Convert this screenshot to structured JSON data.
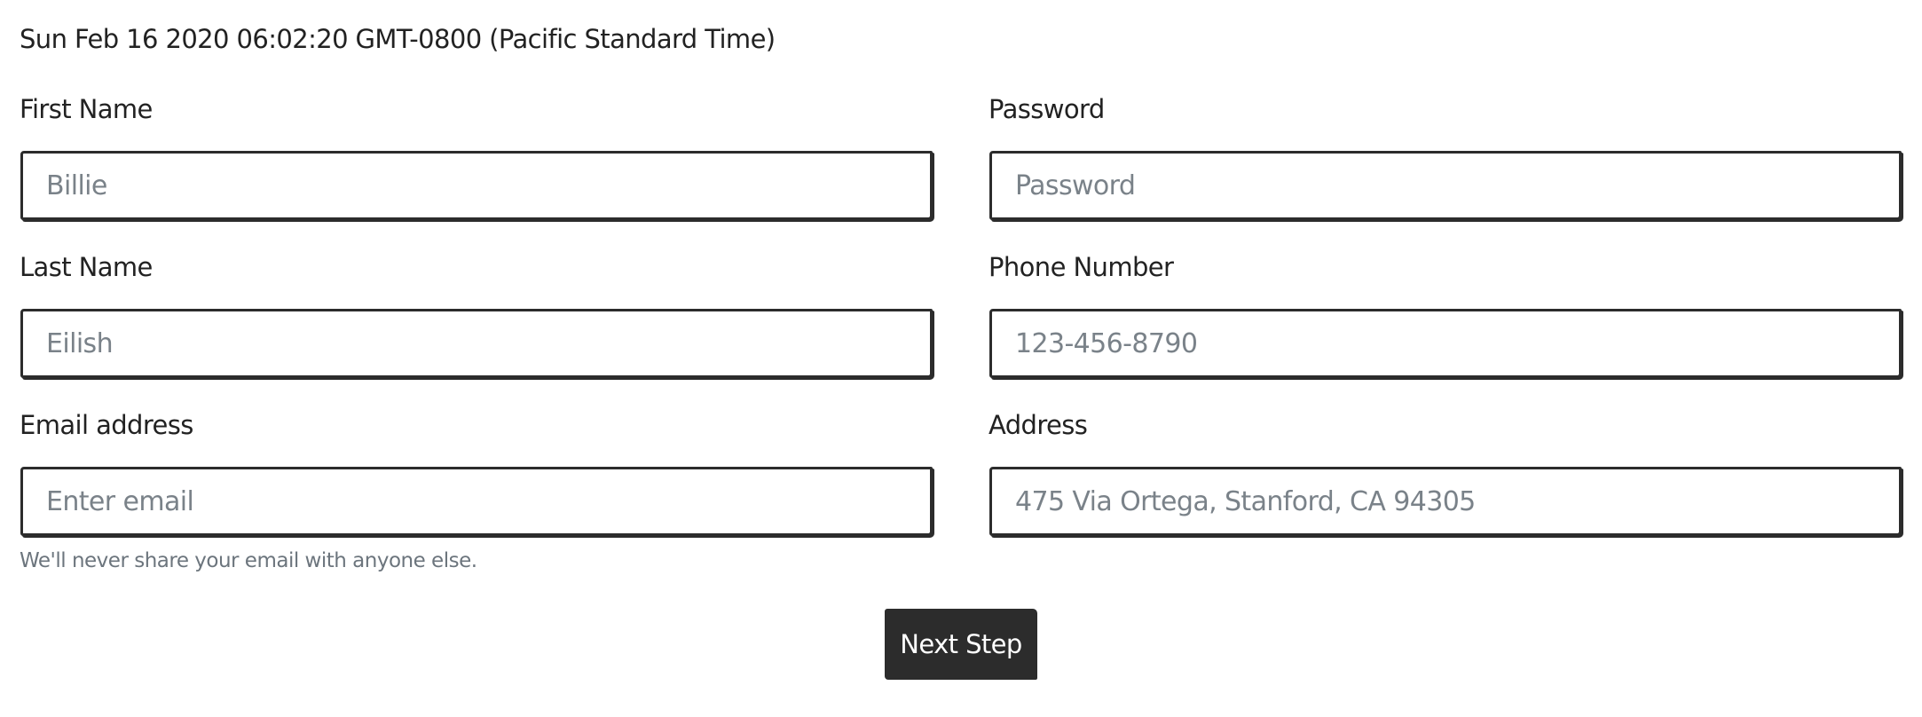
{
  "timestamp": "Sun Feb 16 2020 06:02:20 GMT-0800 (Pacific Standard Time)",
  "form": {
    "first_name": {
      "label": "First Name",
      "placeholder": "Billie"
    },
    "last_name": {
      "label": "Last Name",
      "placeholder": "Eilish"
    },
    "email": {
      "label": "Email address",
      "placeholder": "Enter email",
      "help": "We'll never share your email with anyone else."
    },
    "password": {
      "label": "Password",
      "placeholder": "Password"
    },
    "phone": {
      "label": "Phone Number",
      "placeholder": "123-456-8790"
    },
    "address": {
      "label": "Address",
      "placeholder": "475 Via Ortega, Stanford, CA 94305"
    }
  },
  "next_button": {
    "label": "Next Step"
  },
  "colors": {
    "text": "#222222",
    "border": "#2c2c2c",
    "placeholder": "#7a8289",
    "help_text": "#6c757d",
    "button_bg": "#2c2c2c",
    "button_text": "#ffffff"
  }
}
